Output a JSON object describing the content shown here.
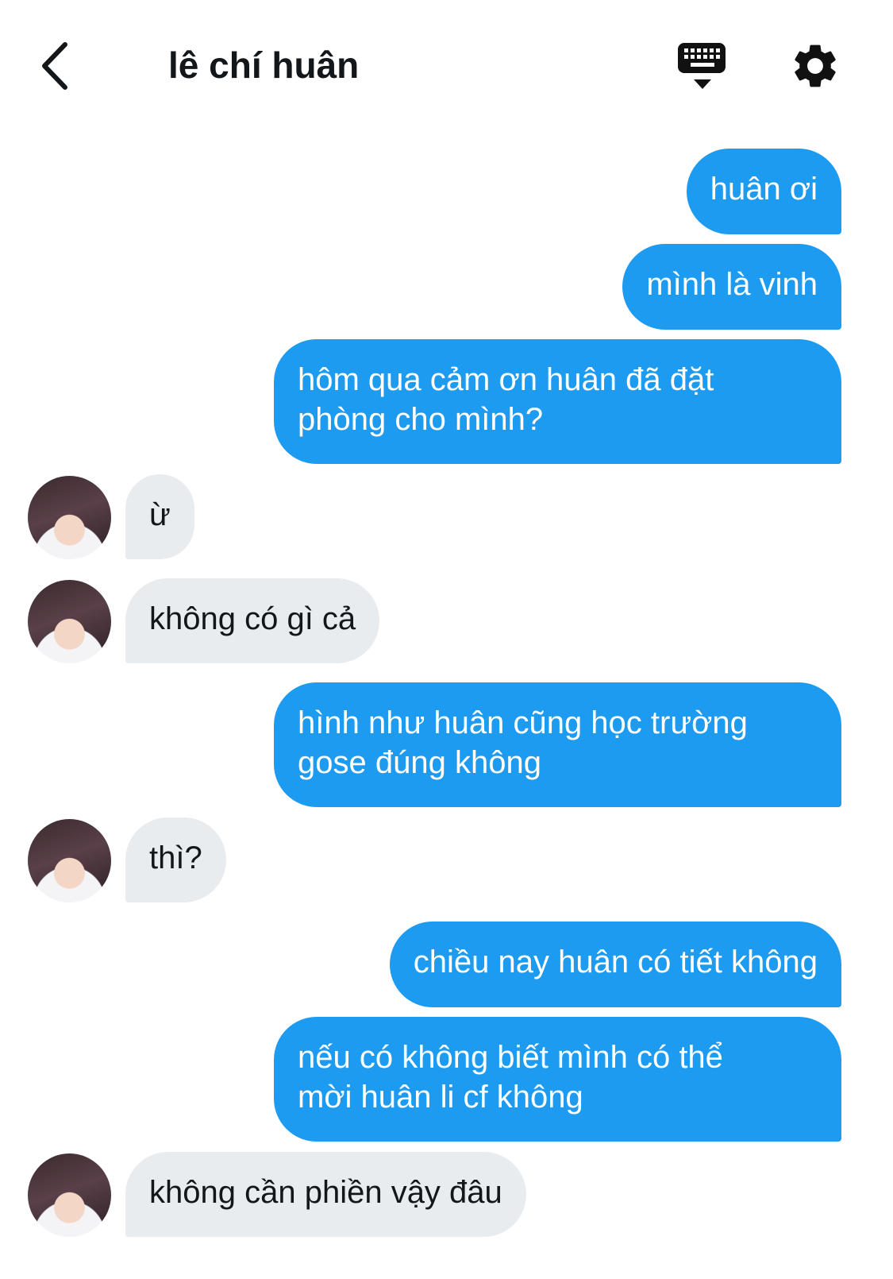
{
  "header": {
    "title": "lê chí huân",
    "back_icon": "chevron-left-icon",
    "keyboard_icon": "keyboard-icon",
    "settings_icon": "gear-icon"
  },
  "colors": {
    "outgoing_bubble": "#1d9bf0",
    "incoming_bubble": "#e9ecef",
    "text_dark": "#14171a"
  },
  "messages": [
    {
      "direction": "out",
      "text": "huân ơi"
    },
    {
      "direction": "out",
      "text": "mình là vinh"
    },
    {
      "direction": "out",
      "lines": [
        "hôm qua cảm ơn huân đã đặt",
        "phòng cho mình?"
      ]
    },
    {
      "direction": "in",
      "text": "ừ"
    },
    {
      "direction": "in",
      "text": "không có gì cả"
    },
    {
      "direction": "out",
      "lines": [
        "hình như huân cũng học trường",
        "gose đúng không"
      ]
    },
    {
      "direction": "in",
      "text": "thì?"
    },
    {
      "direction": "out",
      "text": "chiều nay huân có tiết không"
    },
    {
      "direction": "out",
      "lines": [
        "nếu có không biết mình có thể",
        "mời huân li cf không"
      ]
    },
    {
      "direction": "in",
      "text": "không cần phiền vậy đâu"
    }
  ]
}
